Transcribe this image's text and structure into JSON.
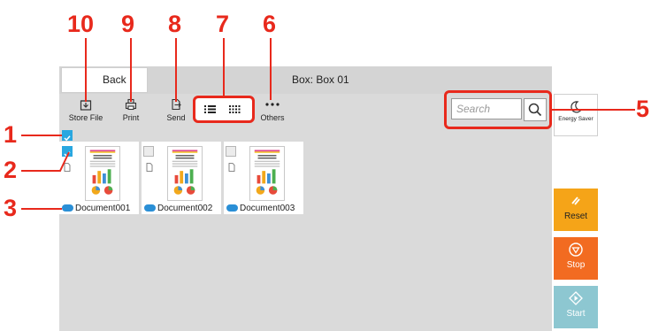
{
  "header": {
    "back_label": "Back",
    "title": "Box: Box 01"
  },
  "toolbar": {
    "store_label": "Store File",
    "print_label": "Print",
    "send_label": "Send",
    "others_label": "Others"
  },
  "search": {
    "placeholder": "Search"
  },
  "side": {
    "energy_label": "Energy Saver",
    "reset_label": "Reset",
    "stop_label": "Stop",
    "start_label": "Start"
  },
  "documents": [
    {
      "name": "Document001",
      "selected": true
    },
    {
      "name": "Document002",
      "selected": false
    },
    {
      "name": "Document003",
      "selected": false
    }
  ],
  "callouts": {
    "c1": "1",
    "c2": "2",
    "c3": "3",
    "c5": "5",
    "c6": "6",
    "c7": "7",
    "c8": "8",
    "c9": "9",
    "c10": "10"
  },
  "colors": {
    "callout": "#e8291c",
    "checkbox": "#29a7e0",
    "reset": "#f5a418",
    "stop": "#f26b21",
    "start": "#8dc7d1"
  }
}
